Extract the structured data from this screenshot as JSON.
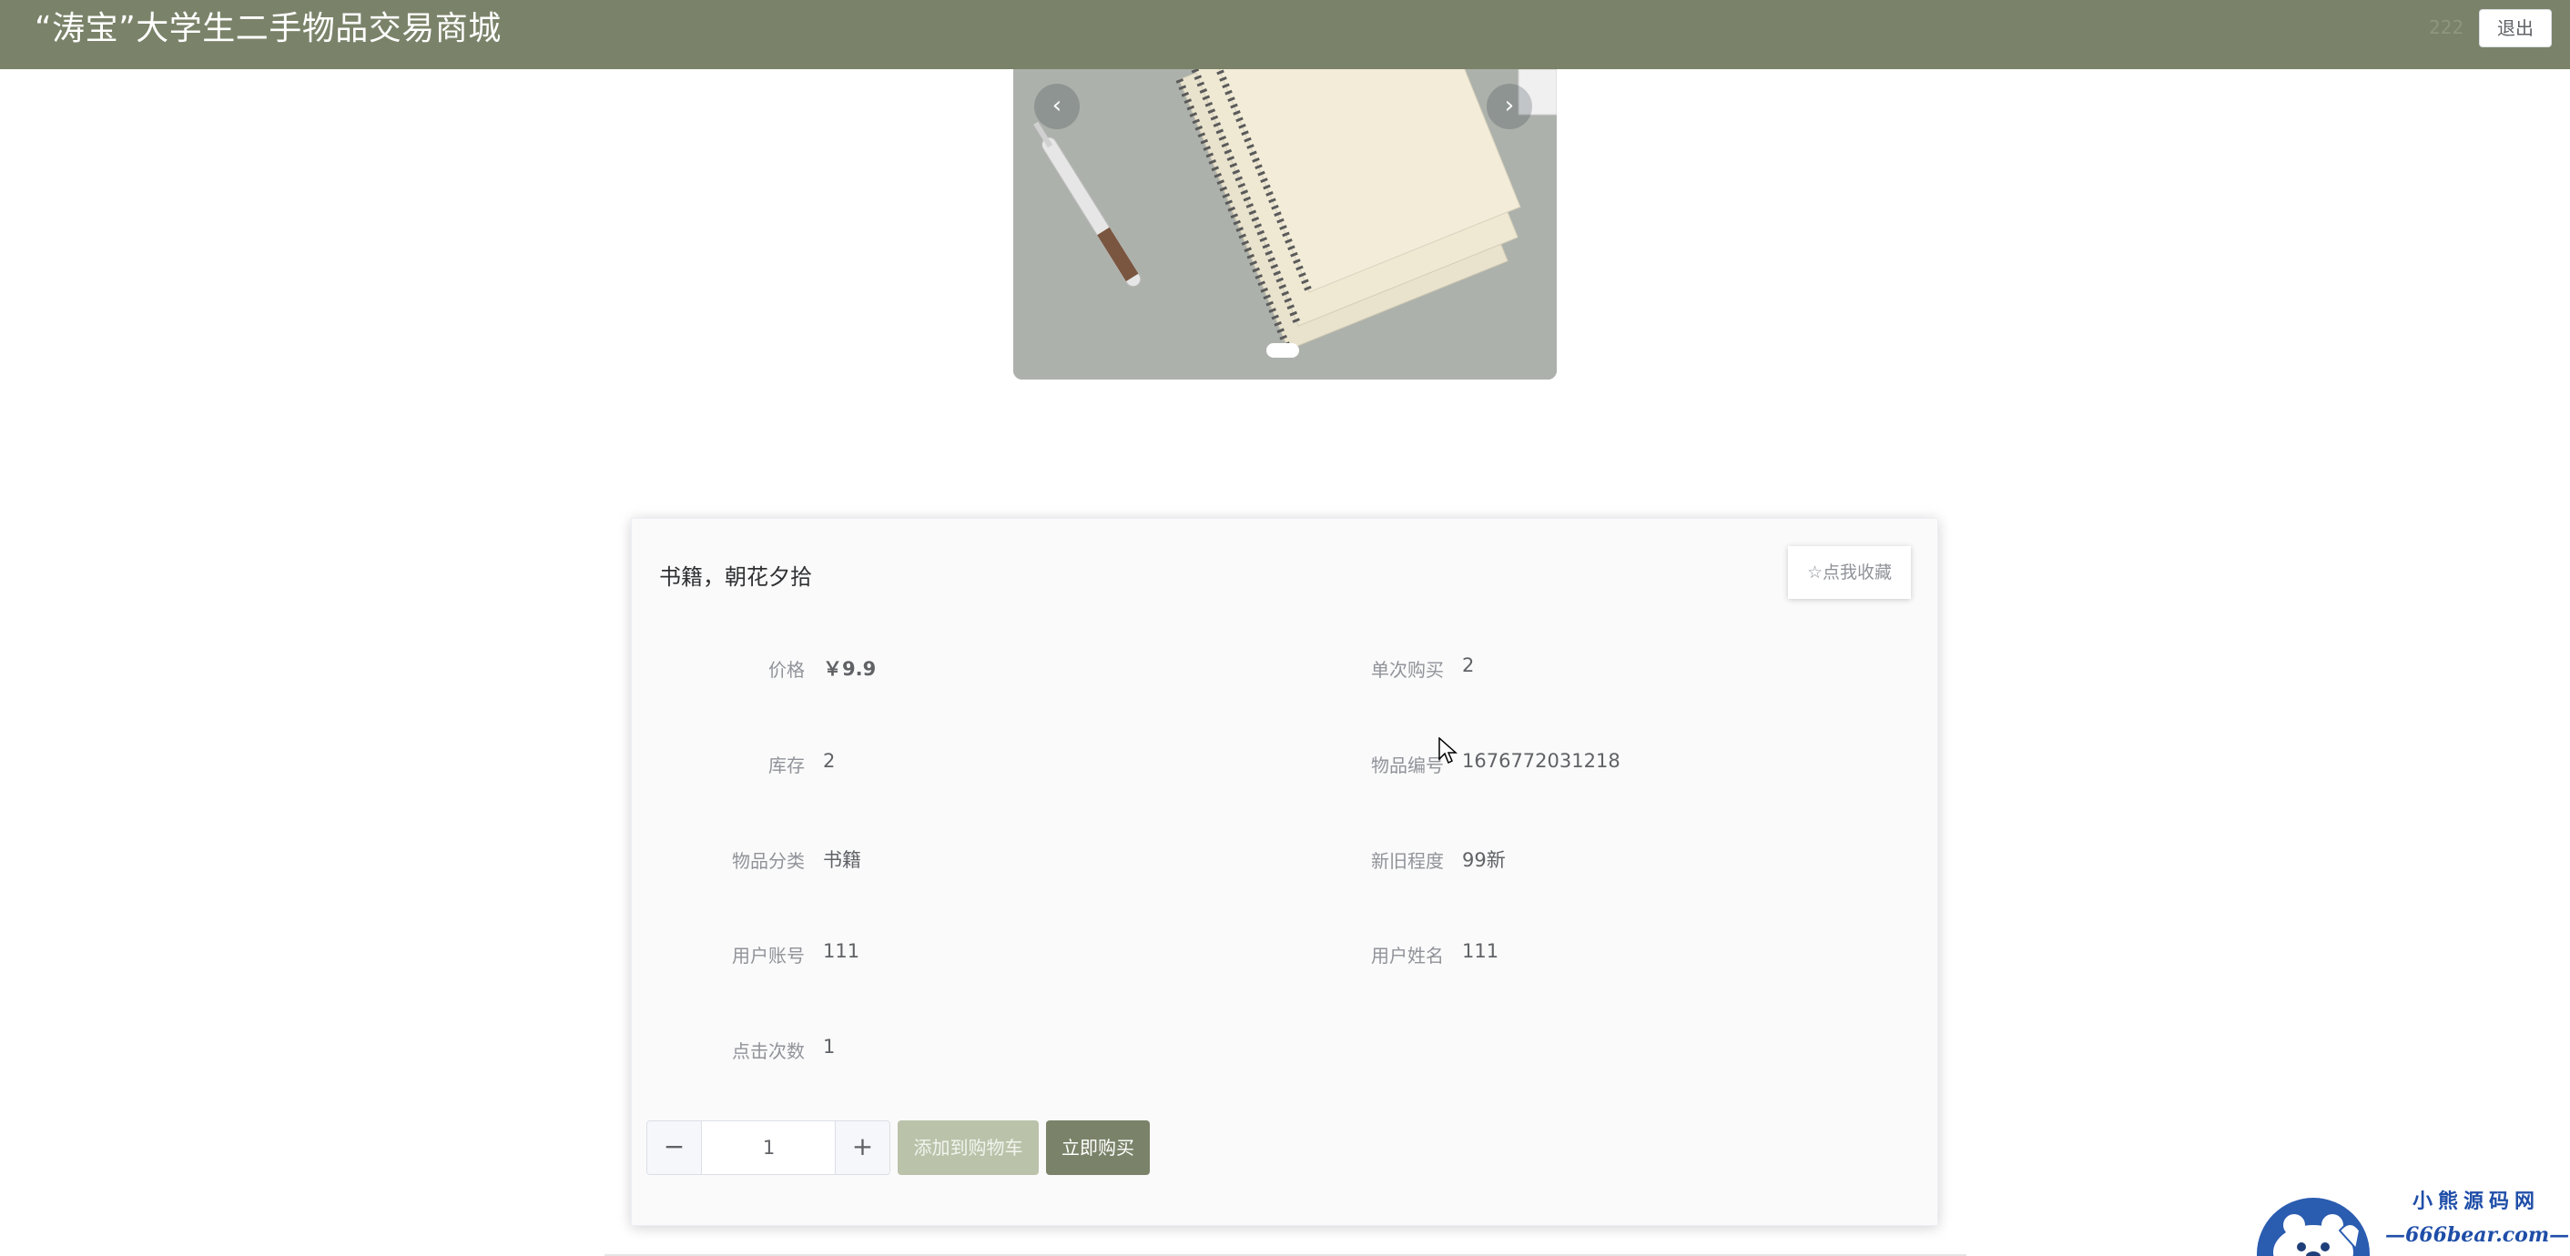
{
  "header": {
    "site_title": "“涛宝”大学生二手物品交易商城",
    "username": "222",
    "logout_label": "退出"
  },
  "carousel": {
    "prev_arrow": "‹",
    "next_arrow": "›",
    "slide_count": 1,
    "active_slide": 1
  },
  "product": {
    "name": "书籍，朝花夕拾",
    "favorite_label": "☆点我收藏",
    "fields": {
      "price_label": "价格",
      "price_value": "￥9.9",
      "single_buy_label": "单次购买",
      "single_buy_value": "2",
      "stock_label": "库存",
      "stock_value": "2",
      "item_no_label": "物品编号",
      "item_no_value": "1676772031218",
      "category_label": "物品分类",
      "category_value": "书籍",
      "condition_label": "新旧程度",
      "condition_value": "99新",
      "account_label": "用户账号",
      "account_value": "111",
      "username_label": "用户姓名",
      "username_value": "111",
      "clicks_label": "点击次数",
      "clicks_value": "1"
    },
    "quantity": "1",
    "minus_label": "−",
    "plus_label": "+",
    "add_to_cart_label": "添加到购物车",
    "buy_now_label": "立即购买"
  },
  "watermark": {
    "title": "小熊源码网",
    "url": "—666bear.com—"
  },
  "colors": {
    "brand": "#7a8369",
    "cart_button": "#bac3aa"
  }
}
